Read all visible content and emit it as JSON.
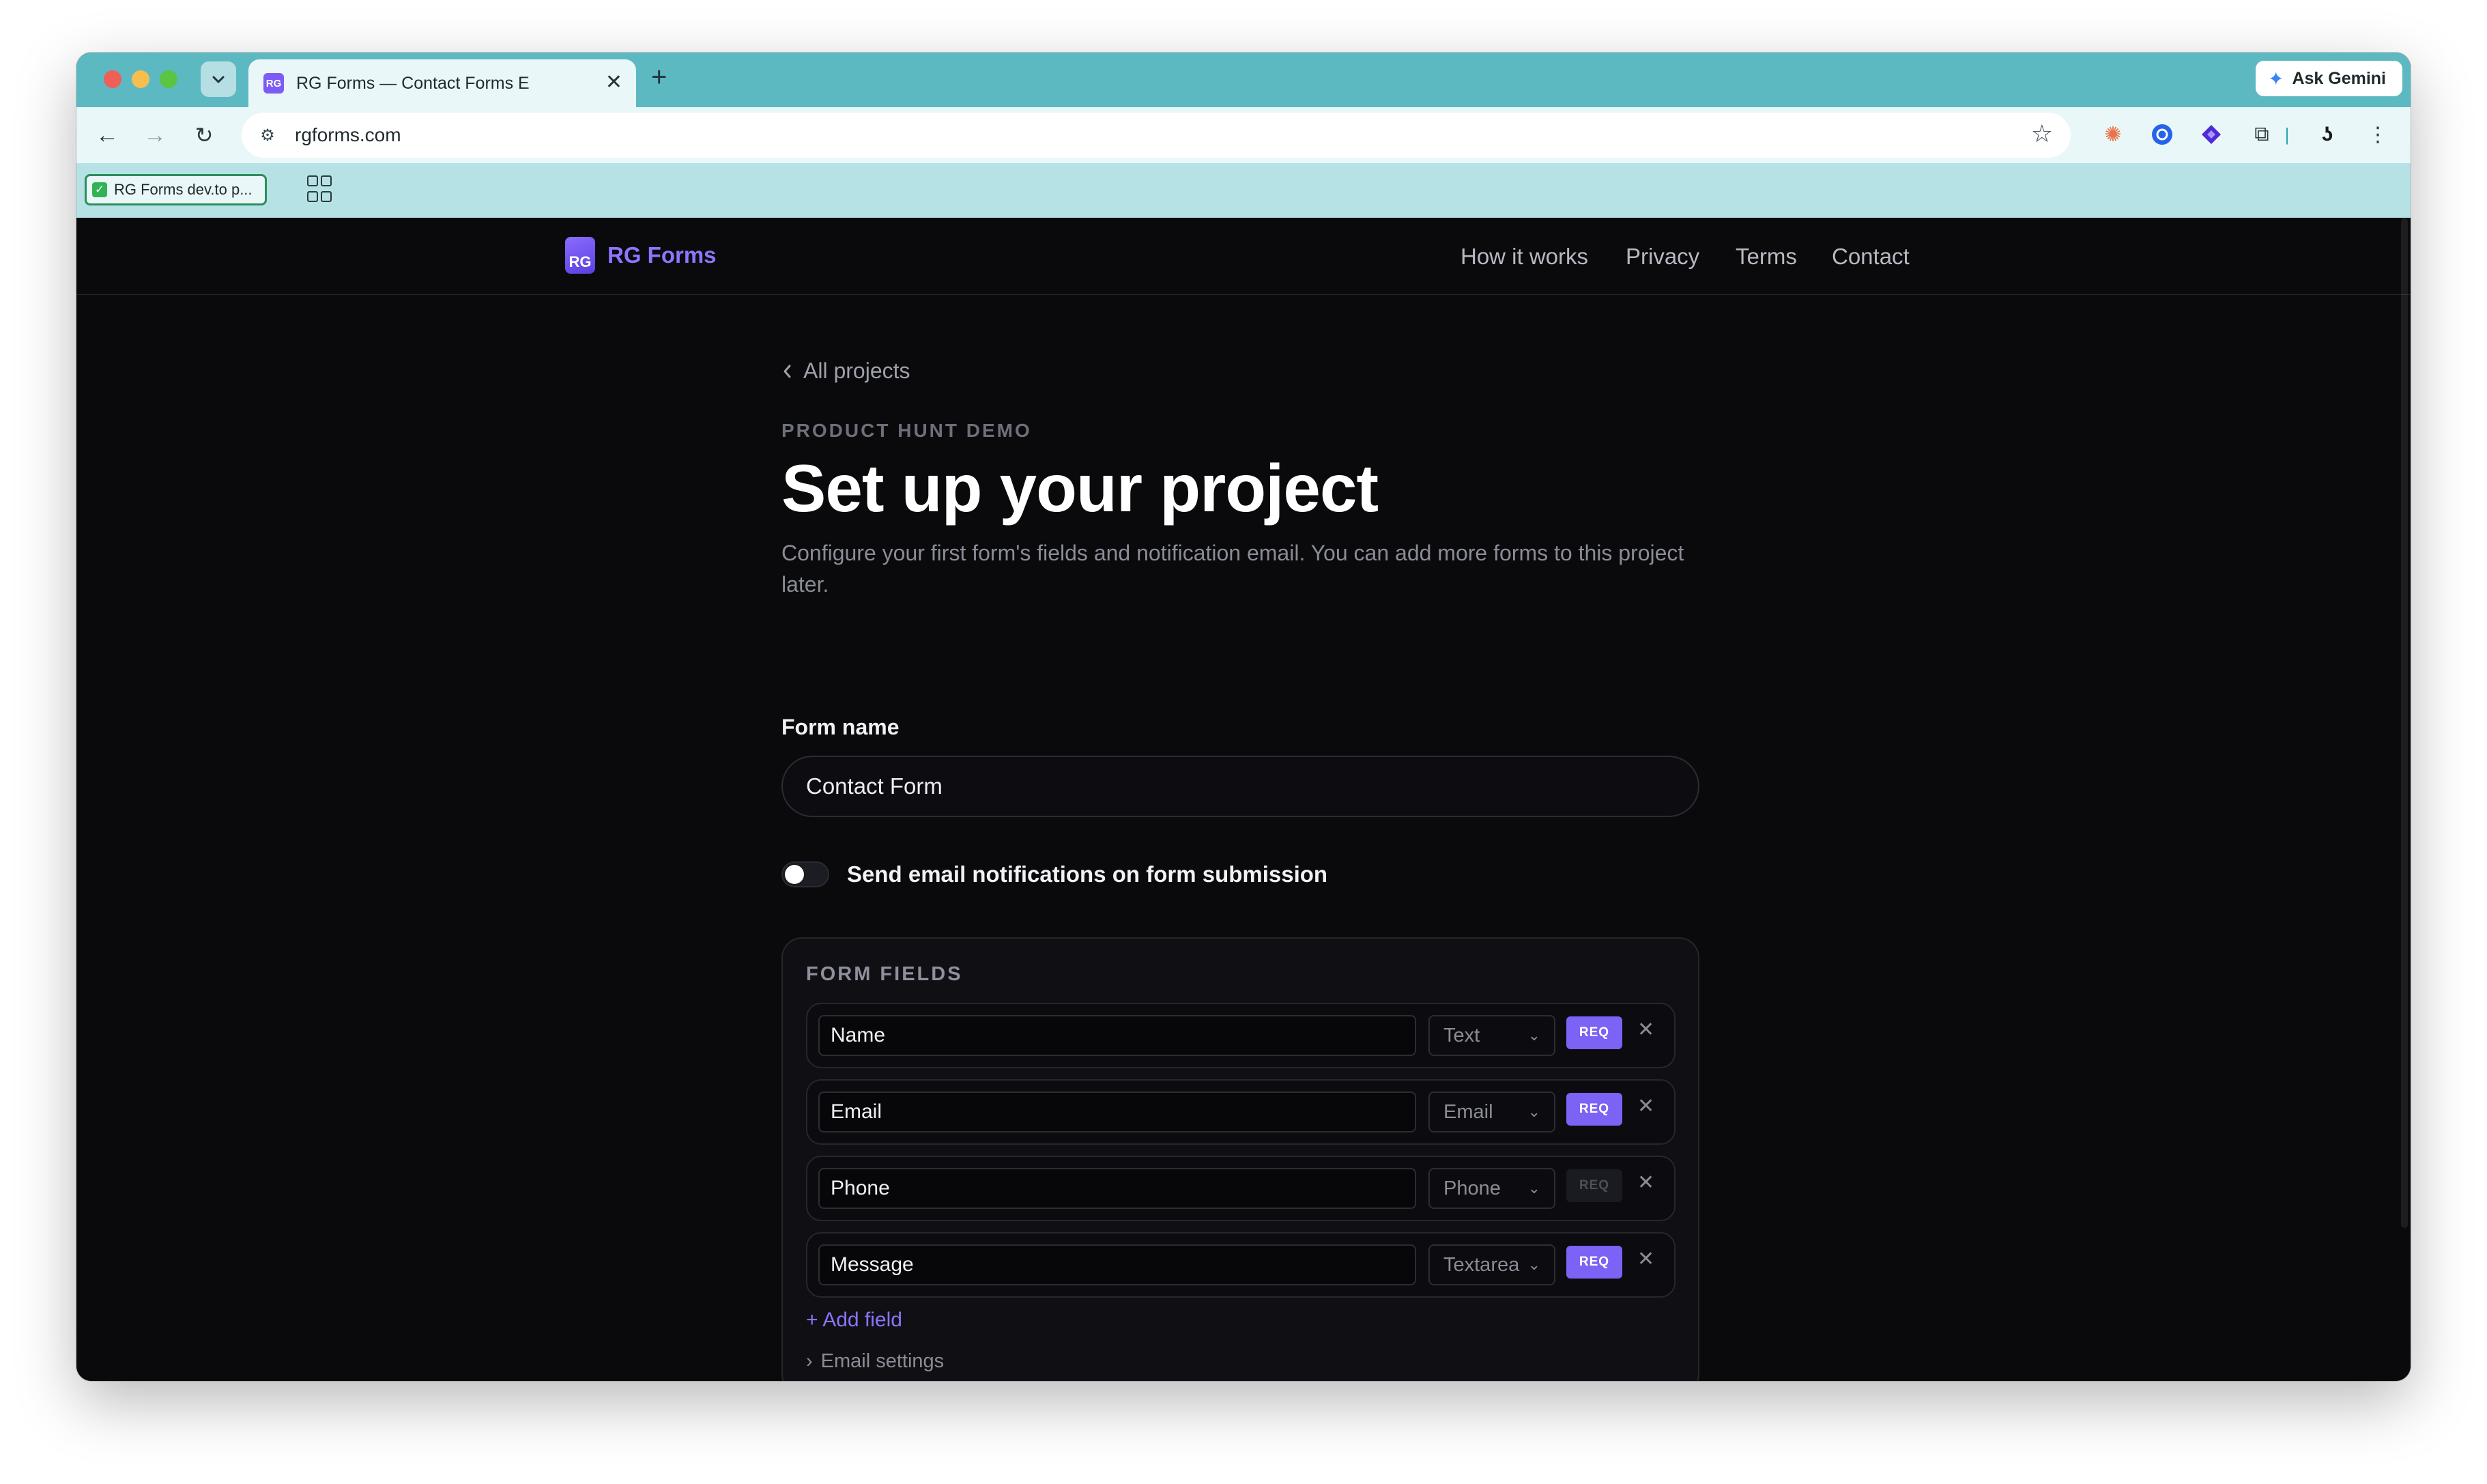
{
  "browser": {
    "tab_title": "RG Forms — Contact Forms E",
    "tab_favicon": "RG",
    "ask_gemini": "Ask Gemini",
    "url": "rgforms.com",
    "bookmark_label": "RG Forms dev.to p..."
  },
  "site": {
    "brand_logo": "RG",
    "brand_name": "RG Forms",
    "nav": [
      "How it works",
      "Privacy",
      "Terms",
      "Contact"
    ]
  },
  "main": {
    "back_link": "All projects",
    "eyebrow": "PRODUCT HUNT DEMO",
    "title": "Set up your project",
    "subtitle": "Configure your first form's fields and notification email. You can add more forms to this project later.",
    "form_name_label": "Form name",
    "form_name_value": "Contact Form",
    "notify_toggle_label": "Send email notifications on form submission",
    "notify_enabled": false
  },
  "fields_section": {
    "title": "FORM FIELDS",
    "req_label": "REQ",
    "fields": [
      {
        "name": "Name",
        "type": "Text",
        "required": true
      },
      {
        "name": "Email",
        "type": "Email",
        "required": true
      },
      {
        "name": "Phone",
        "type": "Phone",
        "required": false
      },
      {
        "name": "Message",
        "type": "Textarea",
        "required": true
      }
    ],
    "add_field": "+ Add field",
    "email_settings": "Email settings"
  },
  "colors": {
    "accent": "#7c62f5",
    "brand": "#8f74ff",
    "background": "#0a0a0c",
    "chrome": "#5cb9c2"
  }
}
